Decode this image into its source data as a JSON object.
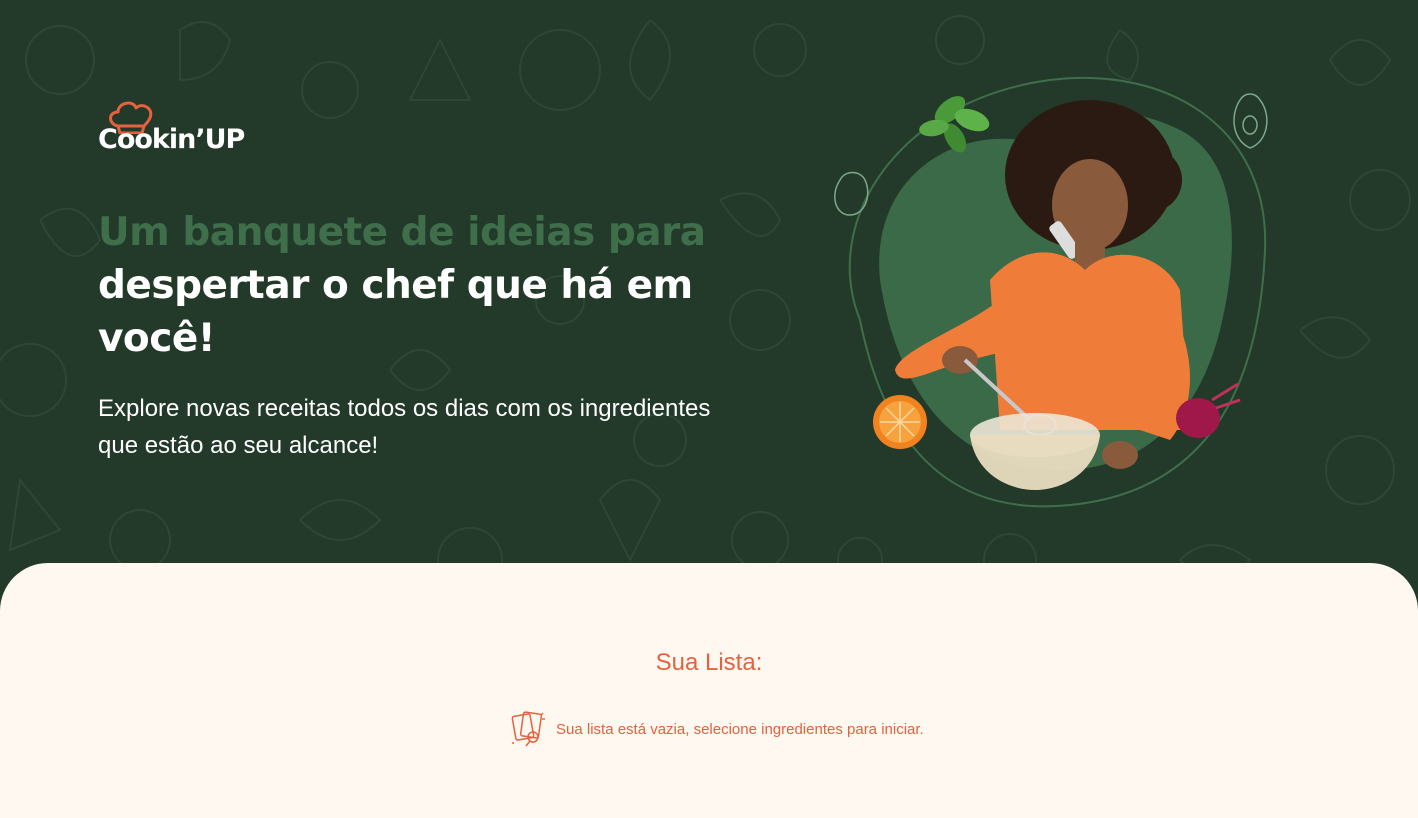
{
  "brand": {
    "logo_text": "Cookin’UP",
    "icon": "chef-hat-icon",
    "colors": {
      "hero_background": "#23392A",
      "headline_green": "#3F6E4B",
      "accent_orange": "#E3623F",
      "section_background": "#FFF8F0"
    }
  },
  "hero": {
    "headline_part1": "Um banquete de ideias para",
    "headline_part2_line1": "despertar o chef que há em",
    "headline_part2_line2": "você!",
    "subtitle_line1": "Explore novas receitas todos os dias com os ingredientes",
    "subtitle_line2": "que estão ao seu alcance!"
  },
  "list": {
    "title": "Sua Lista:",
    "empty_icon": "empty-list-icon",
    "empty_message": "Sua lista está vazia, selecione ingredientes para iniciar."
  }
}
